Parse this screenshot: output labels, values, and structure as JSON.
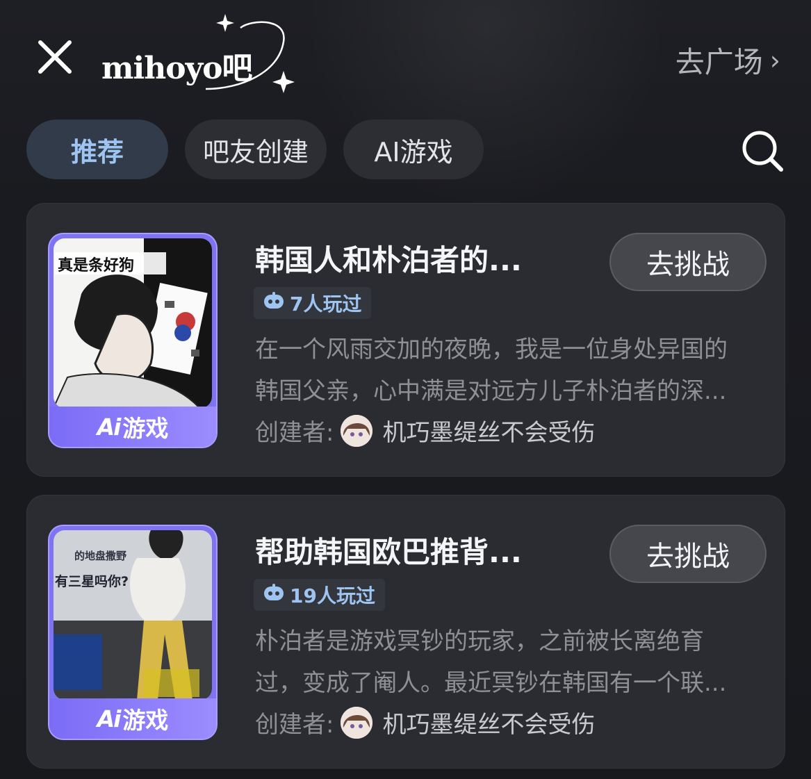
{
  "header": {
    "title": "mihoyo吧",
    "plaza_label": "去广场",
    "plaza_chevron": "›"
  },
  "tabs": [
    {
      "label": "推荐",
      "active": true
    },
    {
      "label": "吧友创建",
      "active": false
    },
    {
      "label": "AI游戏",
      "active": false
    }
  ],
  "cards": [
    {
      "title": "韩国人和朴泊者的...",
      "plays": "7人玩过",
      "desc_line1": "在一个风雨交加的夜晚，我是一位身处异国的",
      "desc_line2": "韩国父亲，心中满是对远方儿子朴泊者的深...",
      "creator_label": "创建者:",
      "creator_name": "机巧墨缇丝不会受伤",
      "button": "去挑战",
      "badge_ai": "Ai",
      "badge_text": "游戏",
      "thumb_caption": "真是条好狗"
    },
    {
      "title": "帮助韩国欧巴推背...",
      "plays": "19人玩过",
      "desc_line1": "朴泊者是游戏冥钞的玩家，之前被长离绝育",
      "desc_line2": "过，变成了阉人。最近冥钞在韩国有一个联...",
      "creator_label": "创建者:",
      "creator_name": "机巧墨缇丝不会受伤",
      "button": "去挑战",
      "badge_ai": "Ai",
      "badge_text": "游戏",
      "thumb_caption1": "的地盘撒野",
      "thumb_caption2": "有三星吗你?"
    }
  ],
  "colors": {
    "accent_blue": "#9ec4f2",
    "badge_purple": "#7e73f2",
    "background": "#1a1b20"
  }
}
